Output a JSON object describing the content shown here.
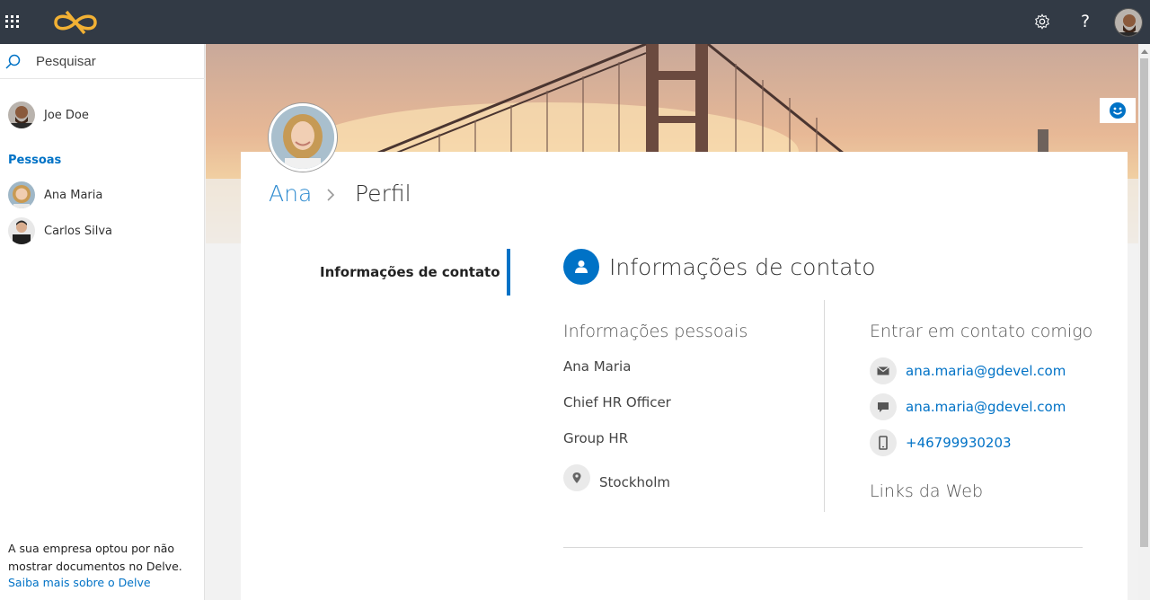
{
  "topbar": {
    "app_launcher_icon": "waffle-icon",
    "logo_icon": "infinity-logo-icon",
    "settings_icon": "gear-icon",
    "help_label": "?",
    "avatar_icon": "user-avatar"
  },
  "sidebar": {
    "search_placeholder": "Pesquisar",
    "current_user": "Joe Doe",
    "people_header": "Pessoas",
    "people": [
      {
        "name": "Ana Maria"
      },
      {
        "name": "Carlos Silva"
      }
    ],
    "footer_note": "A sua empresa optou por não mostrar documentos no Delve.",
    "footer_link": "Saiba mais sobre o Delve"
  },
  "profile": {
    "breadcrumb_name": "Ana",
    "breadcrumb_page": "Perfil",
    "nav_item": "Informações de contato",
    "section_title": "Informações de contato"
  },
  "personal": {
    "heading": "Informações pessoais",
    "name": "Ana Maria",
    "title": "Chief HR Officer",
    "department": "Group HR",
    "location": "Stockholm"
  },
  "contact": {
    "heading": "Entrar em contato comigo",
    "email": "ana.maria@gdevel.com",
    "chat": "ana.maria@gdevel.com",
    "phone": "+46799930203",
    "links_heading": "Links da Web"
  },
  "colors": {
    "topbar": "#323a45",
    "accent": "#0072c6",
    "logo": "#f2b134"
  }
}
